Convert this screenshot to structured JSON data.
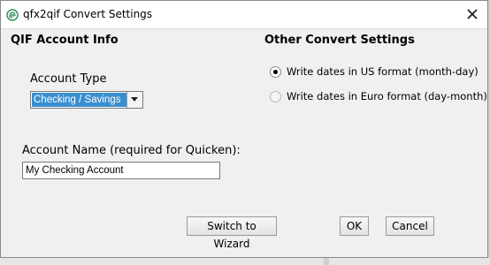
{
  "window": {
    "title": "qfx2qif Convert Settings",
    "app_icon": "fingerprint-icon",
    "close_label": "close-icon"
  },
  "left_panel": {
    "heading": "QIF Account Info",
    "account_type_label": "Account Type",
    "account_type_value": "Checking / Savings",
    "account_name_label": "Account Name (required for Quicken):",
    "account_name_value": "My Checking Account"
  },
  "right_panel": {
    "heading": "Other Convert Settings",
    "options": [
      {
        "label": "Write dates in US format (month-day)",
        "checked": true
      },
      {
        "label": "Write dates in Euro format (day-month)",
        "checked": false
      }
    ]
  },
  "buttons": {
    "wizard": "Switch to Wizard",
    "ok": "OK",
    "cancel": "Cancel"
  },
  "colors": {
    "selection": "#3a8fd0",
    "app_icon": "#2e8b57"
  }
}
